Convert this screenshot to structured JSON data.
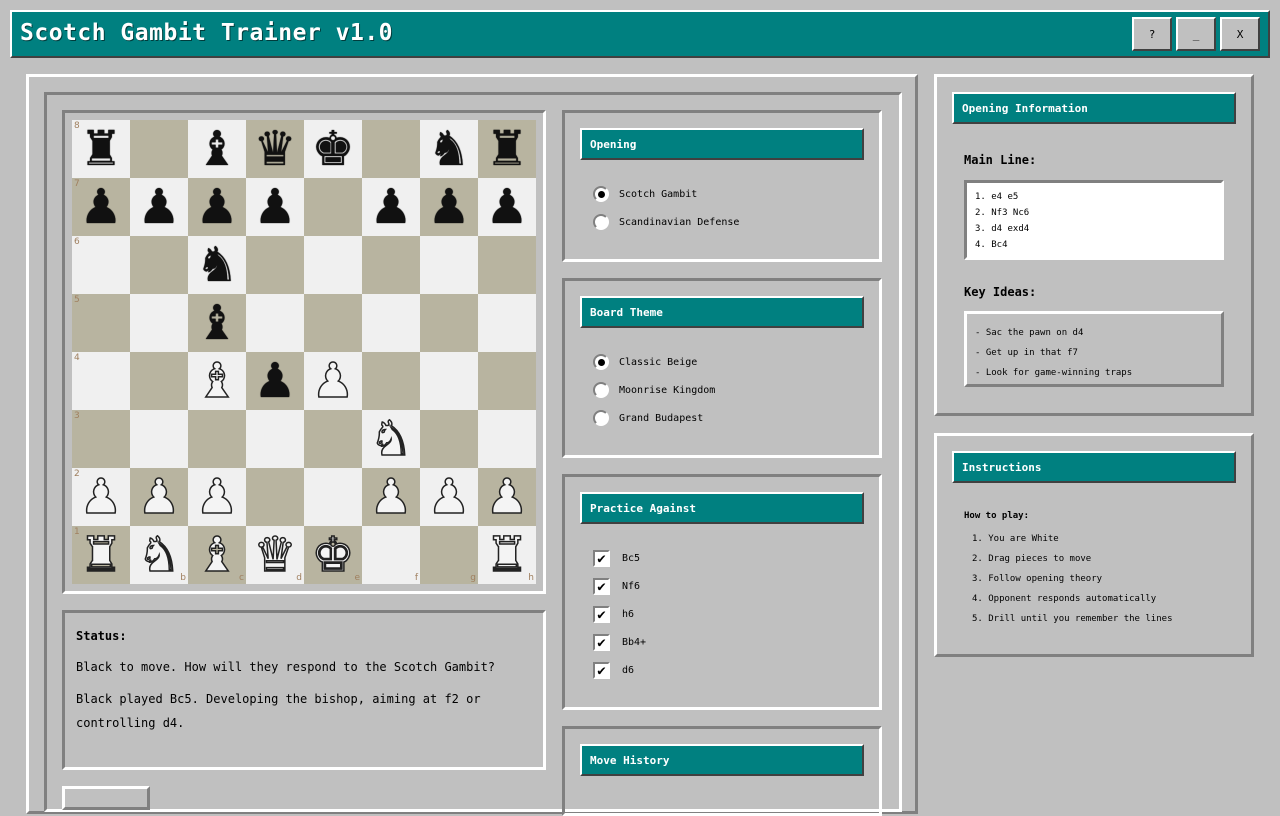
{
  "window": {
    "title": "Scotch Gambit Trainer v1.0",
    "buttons": {
      "help": "?",
      "minimize": "_",
      "close": "X"
    }
  },
  "board": {
    "ranks": [
      "8",
      "7",
      "6",
      "5",
      "4",
      "3",
      "2",
      "1"
    ],
    "files": [
      "a",
      "b",
      "c",
      "d",
      "e",
      "f",
      "g",
      "h"
    ],
    "rows": [
      [
        "bR",
        "",
        "bB",
        "bQ",
        "bK",
        "",
        "bN",
        "bR"
      ],
      [
        "bP",
        "bP",
        "bP",
        "bP",
        "",
        "bP",
        "bP",
        "bP"
      ],
      [
        "",
        "",
        "bN",
        "",
        "",
        "",
        "",
        ""
      ],
      [
        "",
        "",
        "bB",
        "",
        "",
        "",
        "",
        ""
      ],
      [
        "",
        "",
        "wB",
        "bP",
        "wP",
        "",
        "",
        ""
      ],
      [
        "",
        "",
        "",
        "",
        "",
        "wN",
        "",
        ""
      ],
      [
        "wP",
        "wP",
        "wP",
        "",
        "",
        "wP",
        "wP",
        "wP"
      ],
      [
        "wR",
        "wN",
        "wB",
        "wQ",
        "wK",
        "",
        "",
        "wR"
      ]
    ]
  },
  "status": {
    "label": "Status:",
    "line1": "Black to move. How will they respond to the Scotch Gambit?",
    "line2": "Black played Bc5. Developing the bishop, aiming at f2 or controlling d4."
  },
  "opening": {
    "header": "Opening",
    "options": [
      {
        "label": "Scotch Gambit",
        "selected": true
      },
      {
        "label": "Scandinavian Defense",
        "selected": false
      }
    ]
  },
  "theme": {
    "header": "Board Theme",
    "options": [
      {
        "label": "Classic Beige",
        "selected": true
      },
      {
        "label": "Moonrise Kingdom",
        "selected": false
      },
      {
        "label": "Grand Budapest",
        "selected": false
      }
    ]
  },
  "practice": {
    "header": "Practice Against",
    "options": [
      {
        "label": "Bc5",
        "checked": true
      },
      {
        "label": "Nf6",
        "checked": true
      },
      {
        "label": "h6",
        "checked": true
      },
      {
        "label": "Bb4+",
        "checked": true
      },
      {
        "label": "d6",
        "checked": true
      }
    ]
  },
  "history": {
    "header": "Move History"
  },
  "info": {
    "header": "Opening Information",
    "main_line_label": "Main Line:",
    "main_line": [
      "1. e4 e5",
      "2. Nf3 Nc6",
      "3. d4 exd4",
      "4. Bc4"
    ],
    "key_ideas_label": "Key Ideas:",
    "key_ideas": [
      "- Sac the pawn on d4",
      "- Get up in that f7",
      "- Look for game-winning traps"
    ]
  },
  "instructions": {
    "header": "Instructions",
    "how_to": "How to play:",
    "steps": [
      "1. You are White",
      "2. Drag pieces to move",
      "3. Follow opening theory",
      "4. Opponent responds automatically",
      "5. Drill until you remember the lines"
    ]
  },
  "colors": {
    "accent": "#008080",
    "background": "#c0c0c0",
    "light_square": "#f0f0f0",
    "dark_square": "#b8b4a0"
  }
}
